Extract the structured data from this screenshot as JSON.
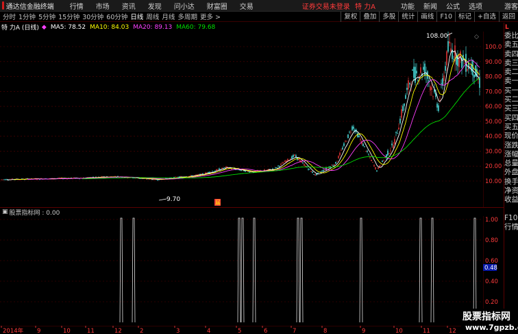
{
  "titlebar": {
    "app_title": "通达信金融终端",
    "menus": [
      "行情",
      "市场",
      "资讯",
      "发现",
      "问小达",
      "财富圈",
      "交易"
    ],
    "notice": "证券交易未登录",
    "stock": "特 力A",
    "right_menus": [
      "功能",
      "新闻",
      "公式",
      "选项"
    ],
    "guest": "游客"
  },
  "toolbar": {
    "periods": [
      "分时",
      "1分钟",
      "5分钟",
      "15分钟",
      "30分钟",
      "60分钟",
      "日线",
      "周线",
      "月线",
      "多周期",
      "更多 >"
    ],
    "active_period": "日线",
    "right_buttons": [
      "复权",
      "叠加",
      "多股",
      "统计",
      "画线",
      "F10",
      "标记",
      "+自选",
      "返回"
    ]
  },
  "infoline": {
    "stock_label": "特 力A (日线)",
    "diamond": "◆",
    "ma5": "MA5: 78.52",
    "ma10": "MA10: 84.03",
    "ma20": "MA20: 89.13",
    "ma60": "MA60: 79.68"
  },
  "colors": {
    "up": "#ff3b3b",
    "down": "#54fcfc",
    "ma5": "#ffffff",
    "ma10": "#ffff00",
    "ma20": "#ff40ff",
    "ma60": "#00e000",
    "axis_text": "#ff3b3b",
    "grid": "#5a0000"
  },
  "main_chart": {
    "price_ticks": [
      "100.0",
      "90.00",
      "80.00",
      "70.00",
      "60.00",
      "50.00",
      "40.00",
      "30.00",
      "20.00",
      "10.00"
    ],
    "high_label": "108.00",
    "low_label": "9.70",
    "event_marker": "届"
  },
  "indicator": {
    "title": "股票指标网 : 0.00",
    "ticks": [
      "1.00",
      "0.80",
      "0.60",
      "0.40",
      "0.20"
    ],
    "current_value": "0.48"
  },
  "dates": [
    "2014年",
    "9",
    "10",
    "11",
    "12",
    "2",
    "3",
    "4",
    "5",
    "6",
    "7",
    "8",
    "9",
    "10",
    "11",
    "12"
  ],
  "right_panel": {
    "head": "L",
    "items": [
      "委比",
      "卖五",
      "卖四",
      "卖三",
      "卖二",
      "卖一",
      "买一",
      "买二",
      "买三",
      "买四",
      "买五",
      "现价",
      "涨跌",
      "涨幅",
      "总量",
      "外盘",
      "换手",
      "净资",
      "收益",
      "",
      "F10",
      "行情"
    ]
  },
  "watermark": {
    "line1": "股票指标网",
    "line2": "www.7gpzb.com"
  },
  "chart_data": {
    "type": "candlestick",
    "ylim": [
      0,
      108
    ],
    "ma_values": {
      "MA5": 78.52,
      "MA10": 84.03,
      "MA20": 89.13,
      "MA60": 79.68
    },
    "high": 108.0,
    "low": 9.7,
    "indicator_spikes": 14,
    "indicator_range": [
      0,
      1
    ]
  }
}
